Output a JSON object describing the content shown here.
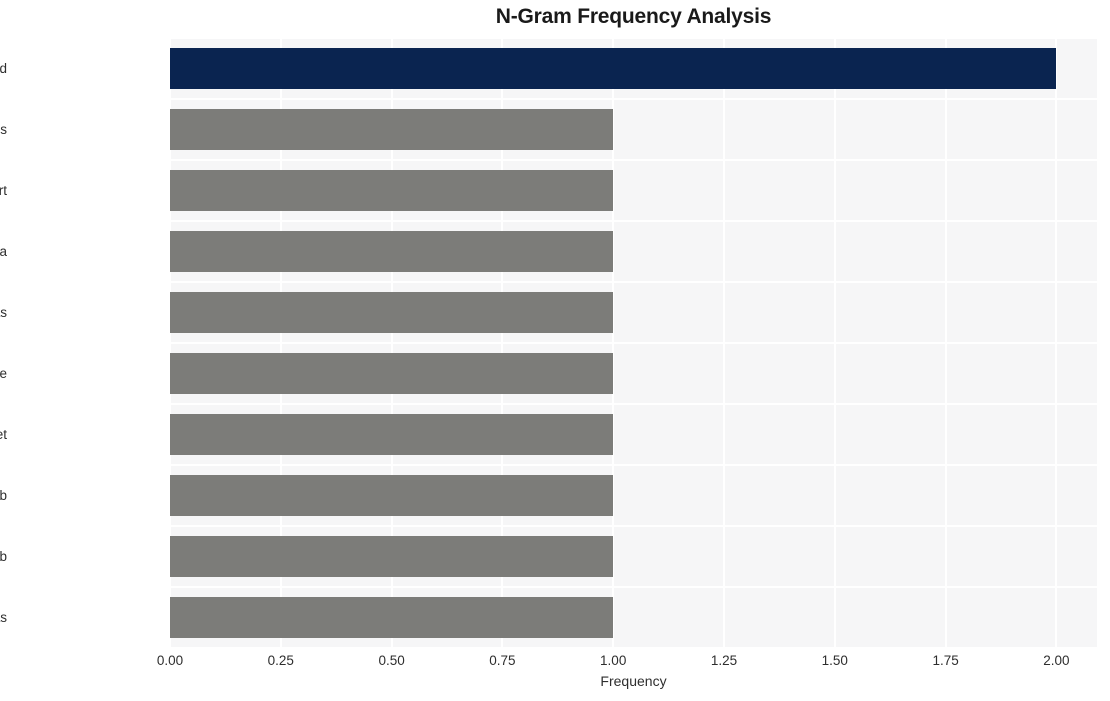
{
  "chart_data": {
    "type": "bar",
    "orientation": "horizontal",
    "title": "N-Gram Frequency Analysis",
    "xlabel": "Frequency",
    "ylabel": "",
    "categories": [
      "usb capture card",
      "hash theres options",
      "theres options export",
      "options export data",
      "export data fpgas",
      "data fpgas like",
      "fpgas like ethernet",
      "like ethernet usb",
      "ethernet usb usb",
      "usb usb fpgas"
    ],
    "values": [
      2,
      1,
      1,
      1,
      1,
      1,
      1,
      1,
      1,
      1
    ],
    "bar_colors": [
      "#0a2450",
      "#7c7c79",
      "#7c7c79",
      "#7c7c79",
      "#7c7c79",
      "#7c7c79",
      "#7c7c79",
      "#7c7c79",
      "#7c7c79",
      "#7c7c79"
    ],
    "xlim": [
      0,
      2
    ],
    "xticks": [
      0,
      0.25,
      0.5,
      0.75,
      1,
      1.25,
      1.5,
      1.75,
      2
    ],
    "xtick_labels": [
      "0.00",
      "0.25",
      "0.50",
      "0.75",
      "1.00",
      "1.25",
      "1.50",
      "1.75",
      "2.00"
    ],
    "grid": true,
    "legend": null,
    "plot_background": "#f6f6f7",
    "grid_color": "#ffffff",
    "figure_background": "#ffffff",
    "highlight_color": "#0a2450",
    "default_bar_color": "#7c7c79"
  }
}
